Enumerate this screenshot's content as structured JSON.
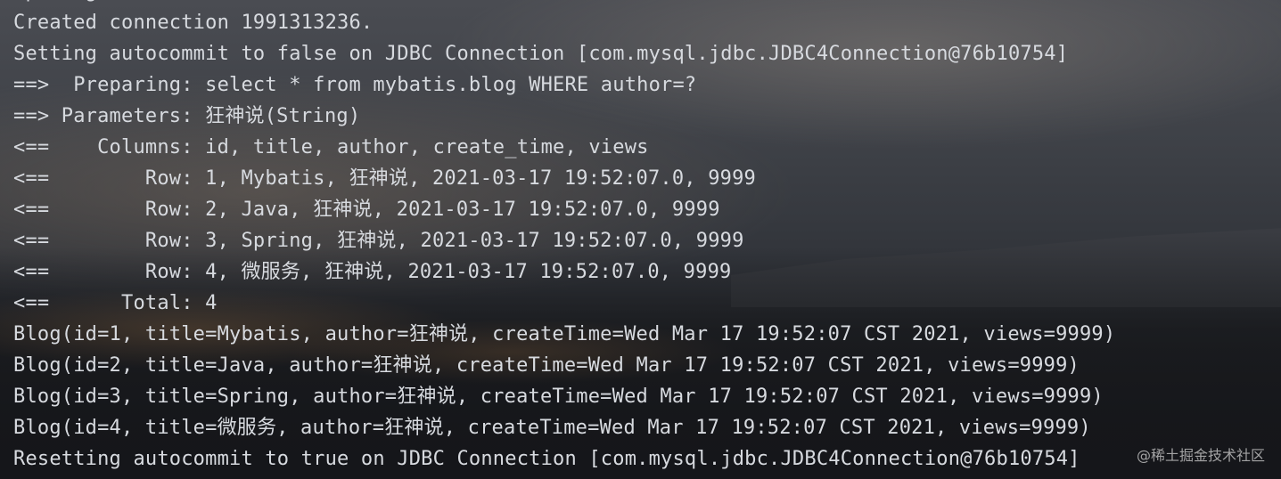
{
  "console": {
    "lines": [
      "Opening JDBC Connection",
      "Created connection 1991313236.",
      "Setting autocommit to false on JDBC Connection [com.mysql.jdbc.JDBC4Connection@76b10754]",
      "==>  Preparing: select * from mybatis.blog WHERE author=?",
      "==> Parameters: 狂神说(String)",
      "<==    Columns: id, title, author, create_time, views",
      "<==        Row: 1, Mybatis, 狂神说, 2021-03-17 19:52:07.0, 9999",
      "<==        Row: 2, Java, 狂神说, 2021-03-17 19:52:07.0, 9999",
      "<==        Row: 3, Spring, 狂神说, 2021-03-17 19:52:07.0, 9999",
      "<==        Row: 4, 微服务, 狂神说, 2021-03-17 19:52:07.0, 9999",
      "<==      Total: 4",
      "Blog(id=1, title=Mybatis, author=狂神说, createTime=Wed Mar 17 19:52:07 CST 2021, views=9999)",
      "Blog(id=2, title=Java, author=狂神说, createTime=Wed Mar 17 19:52:07 CST 2021, views=9999)",
      "Blog(id=3, title=Spring, author=狂神说, createTime=Wed Mar 17 19:52:07 CST 2021, views=9999)",
      "Blog(id=4, title=微服务, author=狂神说, createTime=Wed Mar 17 19:52:07 CST 2021, views=9999)",
      "Resetting autocommit to true on JDBC Connection [com.mysql.jdbc.JDBC4Connection@76b10754]"
    ]
  },
  "watermark": "@稀土掘金技术社区",
  "colors": {
    "console_text": "#d7dadf",
    "background_top": "#4a4c52",
    "background_bottom": "#1b1c1f"
  }
}
